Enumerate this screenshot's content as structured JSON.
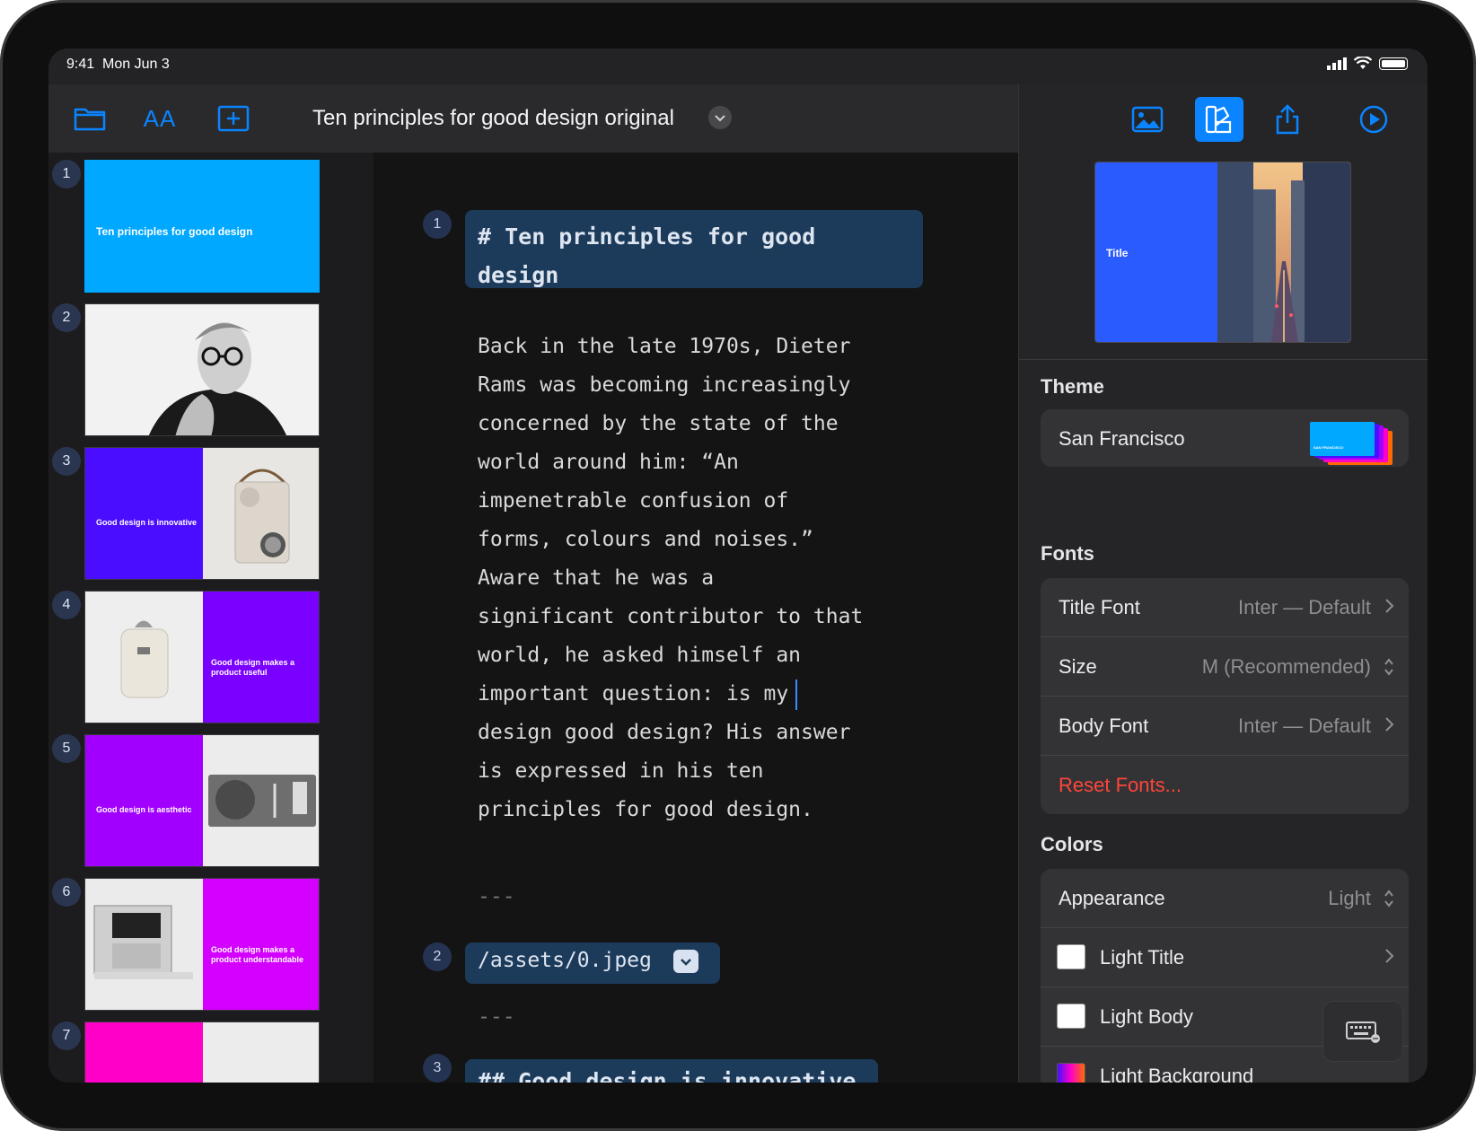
{
  "status_bar": {
    "time": "9:41",
    "date": "Mon Jun 3"
  },
  "toolbar": {
    "doc_title": "Ten principles for good design original",
    "font_button_label": "AA"
  },
  "slides": [
    {
      "number": "1",
      "text": "Ten principles for good design"
    },
    {
      "number": "2",
      "text": ""
    },
    {
      "number": "3",
      "text": "Good design is innovative"
    },
    {
      "number": "4",
      "text": "Good design makes a product useful"
    },
    {
      "number": "5",
      "text": "Good design is aesthetic"
    },
    {
      "number": "6",
      "text": "Good design makes a product understandable"
    },
    {
      "number": "7",
      "text": ""
    }
  ],
  "editor": {
    "block1_number": "1",
    "block1_heading": "# Ten principles for good design",
    "body": "Back in the late 1970s, Dieter\nRams was becoming increasingly\nconcerned by the state of the\nworld around him: “An\nimpenetrable confusion of\nforms, colours and noises.”\nAware that he was a\nsignificant contributor to that\nworld, he asked himself an\nimportant question: is my",
    "body_after_cursor": "design good design? His answer\nis expressed in his ten\nprinciples for good design.",
    "separator": "---",
    "block2_number": "2",
    "block2_asset": "/assets/0.jpeg",
    "block3_number": "3",
    "block3_heading": "## Good design is innovative"
  },
  "inspector": {
    "preview_title": "Title",
    "theme": {
      "section": "Theme",
      "name": "San Francisco",
      "swatch_caption": "SAN FRANCISCO"
    },
    "fonts": {
      "section": "Fonts",
      "title_font_label": "Title Font",
      "title_font_value": "Inter — Default",
      "size_label": "Size",
      "size_value": "M (Recommended)",
      "body_font_label": "Body Font",
      "body_font_value": "Inter — Default",
      "reset_label": "Reset Fonts..."
    },
    "colors": {
      "section": "Colors",
      "appearance_label": "Appearance",
      "appearance_value": "Light",
      "light_title": "Light Title",
      "light_body": "Light Body",
      "light_background": "Light Background"
    }
  },
  "colors": {
    "accent": "#0a84ff",
    "slide1": "#00a8ff",
    "slide3": "#4a0dff",
    "slide4": "#7a00ff",
    "slide5": "#a100ff",
    "slide6": "#d300ff",
    "slide7": "#ff00c8",
    "reset": "#ff453a"
  }
}
